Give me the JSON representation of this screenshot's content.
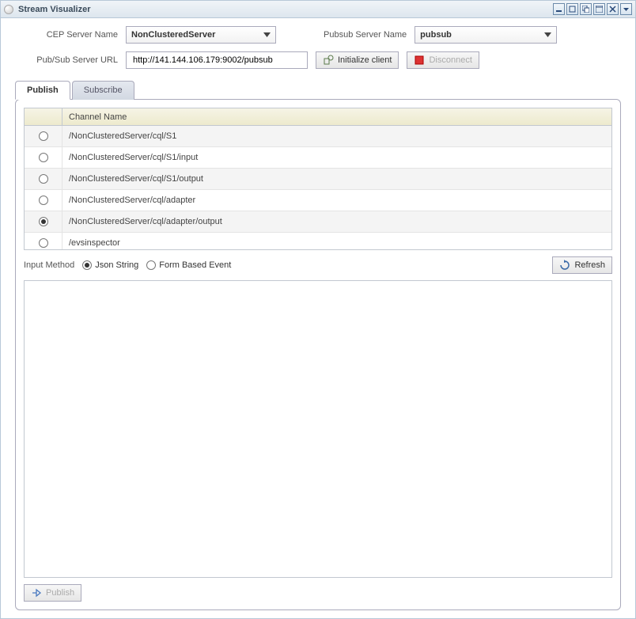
{
  "window": {
    "title": "Stream Visualizer"
  },
  "form": {
    "cep_label": "CEP Server Name",
    "cep_value": "NonClusteredServer",
    "pubsub_label": "Pubsub Server Name",
    "pubsub_value": "pubsub",
    "url_label": "Pub/Sub Server URL",
    "url_value": "http://141.144.106.179:9002/pubsub",
    "init_label": "Initialize client",
    "disconnect_label": "Disconnect"
  },
  "tabs": {
    "publish": "Publish",
    "subscribe": "Subscribe"
  },
  "grid": {
    "header": "Channel Name",
    "rows": [
      {
        "name": "/NonClusteredServer/cql/S1",
        "selected": false
      },
      {
        "name": "/NonClusteredServer/cql/S1/input",
        "selected": false
      },
      {
        "name": "/NonClusteredServer/cql/S1/output",
        "selected": false
      },
      {
        "name": "/NonClusteredServer/cql/adapter",
        "selected": false
      },
      {
        "name": "/NonClusteredServer/cql/adapter/output",
        "selected": true
      },
      {
        "name": "/evsinspector",
        "selected": false
      }
    ]
  },
  "input_method": {
    "label": "Input Method",
    "json": "Json String",
    "form": "Form Based Event",
    "selected": "json",
    "refresh": "Refresh"
  },
  "textarea_value": "",
  "publish_button": "Publish"
}
